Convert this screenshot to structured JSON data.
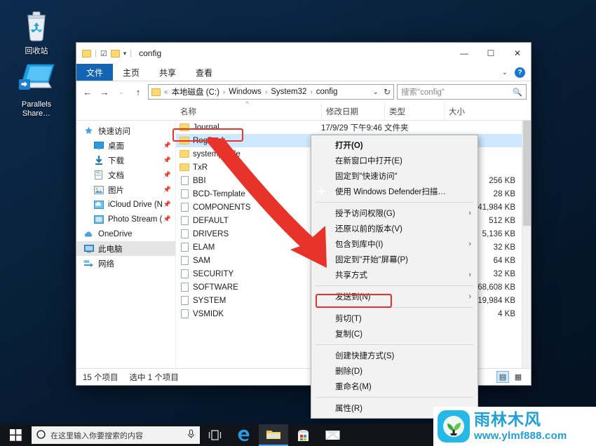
{
  "desktop": {
    "icons": [
      {
        "name": "recycle-bin",
        "label": "回收站"
      },
      {
        "name": "parallels-share",
        "label": "Parallels\nShare…"
      }
    ]
  },
  "window": {
    "title": "config",
    "quick_access": [
      "folder-icon",
      "checkbox-icon",
      "folder-icon",
      "dropdown-caret"
    ],
    "controls": {
      "minimize": "—",
      "maximize": "☐",
      "close": "✕"
    },
    "ribbon": {
      "tabs": [
        {
          "label": "文件",
          "active": true
        },
        {
          "label": "主页",
          "active": false
        },
        {
          "label": "共享",
          "active": false
        },
        {
          "label": "查看",
          "active": false
        }
      ],
      "collapse_caret": "⌄",
      "help_label": "?"
    },
    "nav": {
      "back": "←",
      "forward": "→",
      "recent": "⌄",
      "up": "↑",
      "refresh": "↻",
      "address_caret": "⌄",
      "breadcrumbs": [
        "本地磁盘 (C:)",
        "Windows",
        "System32",
        "config"
      ],
      "breadcrumb_prefix": "«",
      "separator": "›"
    },
    "search": {
      "placeholder": "搜索\"config\"",
      "icon": "search-icon"
    },
    "columns": [
      {
        "key": "name",
        "label": "名称",
        "sorted": true
      },
      {
        "key": "date",
        "label": "修改日期"
      },
      {
        "key": "type",
        "label": "类型"
      },
      {
        "key": "size",
        "label": "大小"
      }
    ],
    "status": {
      "item_count": "15 个项目",
      "selection": "选中 1 个项目"
    },
    "view_buttons": [
      {
        "name": "details-view-button",
        "glyph": "▤",
        "active": true
      },
      {
        "name": "large-icons-view-button",
        "glyph": "▦",
        "active": false
      }
    ]
  },
  "navpane": {
    "items": [
      {
        "label": "快速访问",
        "icon": "star-icon",
        "indent": false,
        "pinned": false,
        "selected": false
      },
      {
        "label": "桌面",
        "icon": "desktop-icon",
        "indent": true,
        "pinned": true,
        "selected": false
      },
      {
        "label": "下载",
        "icon": "download-icon",
        "indent": true,
        "pinned": true,
        "selected": false
      },
      {
        "label": "文档",
        "icon": "document-icon",
        "indent": true,
        "pinned": true,
        "selected": false
      },
      {
        "label": "图片",
        "icon": "pictures-icon",
        "indent": true,
        "pinned": true,
        "selected": false
      },
      {
        "label": "iCloud Drive (N",
        "icon": "icloud-icon",
        "indent": true,
        "pinned": true,
        "selected": false
      },
      {
        "label": "Photo Stream (",
        "icon": "photostream-icon",
        "indent": true,
        "pinned": true,
        "selected": false
      },
      {
        "label": "OneDrive",
        "icon": "onedrive-icon",
        "indent": false,
        "pinned": false,
        "selected": false
      },
      {
        "label": "此电脑",
        "icon": "thispc-icon",
        "indent": false,
        "pinned": false,
        "selected": true
      },
      {
        "label": "网络",
        "icon": "network-icon",
        "indent": false,
        "pinned": false,
        "selected": false
      }
    ]
  },
  "files": [
    {
      "name": "Journal",
      "icon": "folder-icon",
      "date": "17/9/29 下午9:46",
      "type": "文件夹",
      "size": "",
      "selected": false
    },
    {
      "name": "RegBack",
      "icon": "folder-icon",
      "date": "",
      "type": "",
      "size": "",
      "selected": true
    },
    {
      "name": "systemprofile",
      "icon": "folder-icon",
      "date": "",
      "type": "",
      "size": "",
      "selected": false
    },
    {
      "name": "TxR",
      "icon": "folder-icon",
      "date": "",
      "type": "",
      "size": "",
      "selected": false
    },
    {
      "name": "BBI",
      "icon": "file-icon",
      "date": "",
      "type": "",
      "size": "256 KB",
      "selected": false
    },
    {
      "name": "BCD-Template",
      "icon": "file-icon",
      "date": "",
      "type": "",
      "size": "28 KB",
      "selected": false
    },
    {
      "name": "COMPONENTS",
      "icon": "file-icon",
      "date": "",
      "type": "",
      "size": "41,984 KB",
      "selected": false
    },
    {
      "name": "DEFAULT",
      "icon": "file-icon",
      "date": "",
      "type": "",
      "size": "512 KB",
      "selected": false
    },
    {
      "name": "DRIVERS",
      "icon": "file-icon",
      "date": "",
      "type": "",
      "size": "5,136 KB",
      "selected": false
    },
    {
      "name": "ELAM",
      "icon": "file-icon",
      "date": "",
      "type": "",
      "size": "32 KB",
      "selected": false
    },
    {
      "name": "SAM",
      "icon": "file-icon",
      "date": "",
      "type": "",
      "size": "64 KB",
      "selected": false
    },
    {
      "name": "SECURITY",
      "icon": "file-icon",
      "date": "",
      "type": "",
      "size": "32 KB",
      "selected": false
    },
    {
      "name": "SOFTWARE",
      "icon": "file-icon",
      "date": "",
      "type": "",
      "size": "68,608 KB",
      "selected": false
    },
    {
      "name": "SYSTEM",
      "icon": "file-icon",
      "date": "",
      "type": "",
      "size": "19,984 KB",
      "selected": false
    },
    {
      "name": "VSMIDK",
      "icon": "file-icon",
      "date": "",
      "type": "",
      "size": "4 KB",
      "selected": false
    }
  ],
  "context_menu": {
    "items": [
      {
        "label": "打开(O)",
        "bold": true,
        "submenu": false,
        "icon": null,
        "sep_after": false
      },
      {
        "label": "在新窗口中打开(E)",
        "bold": false,
        "submenu": false,
        "icon": null,
        "sep_after": false
      },
      {
        "label": "固定到\"快速访问\"",
        "bold": false,
        "submenu": false,
        "icon": null,
        "sep_after": false
      },
      {
        "label": "使用 Windows Defender扫描…",
        "bold": false,
        "submenu": false,
        "icon": "defender-icon",
        "sep_after": true
      },
      {
        "label": "授予访问权限(G)",
        "bold": false,
        "submenu": true,
        "icon": null,
        "sep_after": false
      },
      {
        "label": "还原以前的版本(V)",
        "bold": false,
        "submenu": false,
        "icon": null,
        "sep_after": false
      },
      {
        "label": "包含到库中(I)",
        "bold": false,
        "submenu": true,
        "icon": null,
        "sep_after": false
      },
      {
        "label": "固定到\"开始\"屏幕(P)",
        "bold": false,
        "submenu": false,
        "icon": null,
        "sep_after": false
      },
      {
        "label": "共享方式",
        "bold": false,
        "submenu": true,
        "icon": null,
        "sep_after": true
      },
      {
        "label": "发送到(N)",
        "bold": false,
        "submenu": true,
        "icon": null,
        "sep_after": true
      },
      {
        "label": "剪切(T)",
        "bold": false,
        "submenu": false,
        "icon": null,
        "sep_after": false
      },
      {
        "label": "复制(C)",
        "bold": false,
        "submenu": false,
        "icon": null,
        "sep_after": true,
        "highlighted": true
      },
      {
        "label": "创建快捷方式(S)",
        "bold": false,
        "submenu": false,
        "icon": null,
        "sep_after": false
      },
      {
        "label": "删除(D)",
        "bold": false,
        "submenu": false,
        "icon": null,
        "sep_after": false
      },
      {
        "label": "重命名(M)",
        "bold": false,
        "submenu": false,
        "icon": null,
        "sep_after": true
      },
      {
        "label": "属性(R)",
        "bold": false,
        "submenu": false,
        "icon": null,
        "sep_after": false
      }
    ]
  },
  "annotations": {
    "accent_color": "#e8332a",
    "highlight_regback": "RegBack",
    "highlight_copy": "复制(C)",
    "arrow": "red-down-right-arrow"
  },
  "taskbar": {
    "start": "start-button",
    "search_placeholder": "在这里输入你要搜索的内容",
    "search_icon": "circle-search-icon",
    "mic_icon": "microphone-icon",
    "icons": [
      {
        "name": "task-view-icon",
        "glyph": "❐"
      },
      {
        "name": "edge-icon",
        "glyph": "e"
      },
      {
        "name": "file-explorer-icon",
        "glyph": "▬",
        "active": true
      },
      {
        "name": "store-icon",
        "glyph": "▣"
      },
      {
        "name": "mail-icon",
        "glyph": "✉"
      }
    ]
  },
  "watermark": {
    "brand": "雨林木风",
    "url": "www.ylmf888.com",
    "logo": "sprout-logo"
  }
}
